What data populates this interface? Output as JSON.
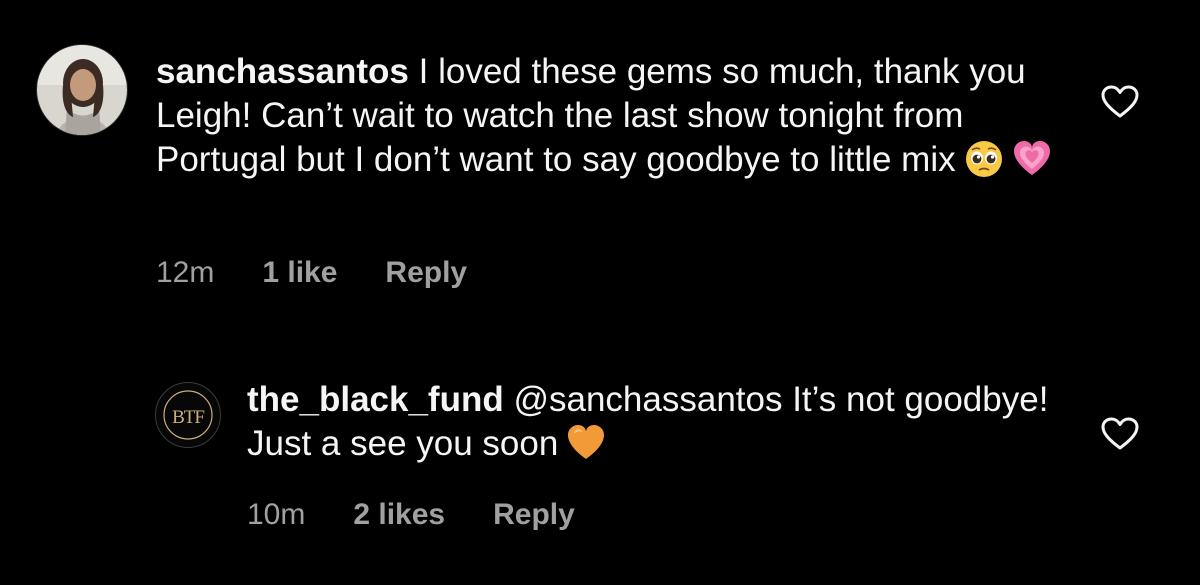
{
  "comments": [
    {
      "username": "sanchassantos",
      "text": " I loved these gems so much, thank you Leigh! Can’t wait to watch the last show tonight from Portugal but I don’t want to say goodbye to little mix",
      "emojis": [
        "pleading-face",
        "growing-heart"
      ],
      "time": "12m",
      "likes": "1 like",
      "reply_label": "Reply",
      "like_icon": "heart-outline-icon"
    },
    {
      "username": "the_black_fund",
      "mention": " @sanchassantos",
      "text": " It’s not goodbye! Just a see you soon",
      "emojis": [
        "orange-heart"
      ],
      "time": "10m",
      "likes": "2 likes",
      "reply_label": "Reply",
      "like_icon": "heart-outline-icon",
      "avatar_logo": "BTF"
    }
  ],
  "colors": {
    "background": "#000000",
    "text": "#f5f5f5",
    "meta": "#a0a0a0",
    "pink_heart": "#f06aa8",
    "orange_heart": "#f29a38",
    "brand_gold": "#c9b07a"
  }
}
